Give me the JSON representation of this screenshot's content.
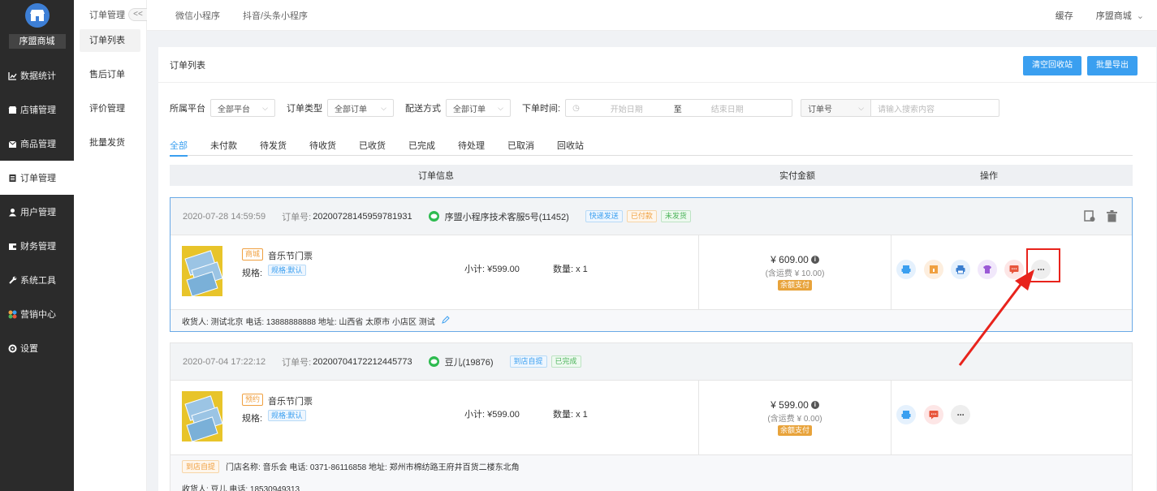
{
  "sidebar": {
    "shop_name": "序盟商城",
    "items": [
      {
        "label": "数据统计",
        "icon": "chart-icon"
      },
      {
        "label": "店铺管理",
        "icon": "store-icon"
      },
      {
        "label": "商品管理",
        "icon": "goods-icon"
      },
      {
        "label": "订单管理",
        "icon": "order-icon"
      },
      {
        "label": "用户管理",
        "icon": "user-icon"
      },
      {
        "label": "财务管理",
        "icon": "finance-icon"
      },
      {
        "label": "系统工具",
        "icon": "wrench-icon"
      },
      {
        "label": "营销中心",
        "icon": "marketing-icon"
      },
      {
        "label": "设置",
        "icon": "gear-icon"
      }
    ],
    "active_index": 3
  },
  "subbar": {
    "title": "订单管理",
    "collapse_label": "<<",
    "items": [
      "订单列表",
      "售后订单",
      "评价管理",
      "批量发货"
    ]
  },
  "topbar": {
    "tabs": [
      "微信小程序",
      "抖音/头条小程序"
    ],
    "cache": "缓存",
    "store": "序盟商城"
  },
  "main": {
    "title": "订单列表",
    "clear_recycle": "清空回收站",
    "batch_export": "批量导出"
  },
  "filters": {
    "platform_label": "所属平台",
    "platform_value": "全部平台",
    "type_label": "订单类型",
    "type_value": "全部订单",
    "delivery_label": "配送方式",
    "delivery_value": "全部订单",
    "time_label": "下单时间:",
    "start_placeholder": "开始日期",
    "to": "至",
    "end_placeholder": "结束日期",
    "search_field": "订单号",
    "search_placeholder": "请输入搜索内容"
  },
  "tabs": [
    "全部",
    "未付款",
    "待发货",
    "待收货",
    "已收货",
    "已完成",
    "待处理",
    "已取消",
    "回收站"
  ],
  "table_head": {
    "info": "订单信息",
    "amount": "实付金额",
    "ops": "操作"
  },
  "orders": [
    {
      "date": "2020-07-28 14:59:59",
      "no_label": "订单号:",
      "no": "20200728145959781931",
      "user": "序盟小程序技术客服5号(11452)",
      "badges": [
        "快递发送",
        "已付款",
        "未发货"
      ],
      "goods_tag": "商城",
      "goods_name": "音乐节门票",
      "spec_label": "规格:",
      "spec": "规格:默认",
      "subtotal": "小计: ¥599.00",
      "qty": "数量: x 1",
      "price": "¥ 609.00",
      "shipping": "(含运费 ¥ 10.00)",
      "pay": "余额支付",
      "footer": "收货人: 测试北京 电话: 13888888888 地址: 山西省 太原市 小店区 测试",
      "more": "···"
    },
    {
      "date": "2020-07-04 17:22:12",
      "no_label": "订单号:",
      "no": "20200704172212445773",
      "user": "豆儿(19876)",
      "badges": [
        "到店自提",
        "已完成"
      ],
      "goods_tag": "预约",
      "goods_name": "音乐节门票",
      "spec_label": "规格:",
      "spec": "规格:默认",
      "subtotal": "小计: ¥599.00",
      "qty": "数量: x 1",
      "price": "¥ 599.00",
      "shipping": "(含运费 ¥ 0.00)",
      "pay": "余额支付",
      "pickup_tag": "到店自提",
      "pickup": "门店名称: 音乐会 电话: 0371-86116858 地址: 郑州市棉纺路王府井百货二楼东北角",
      "footer": "收货人: 豆儿 电话: 18530949313",
      "more": "···"
    }
  ],
  "colors": {
    "accent": "#3a9ff0",
    "sidebar": "#2b2b2b",
    "highlight": "#e8231c"
  }
}
